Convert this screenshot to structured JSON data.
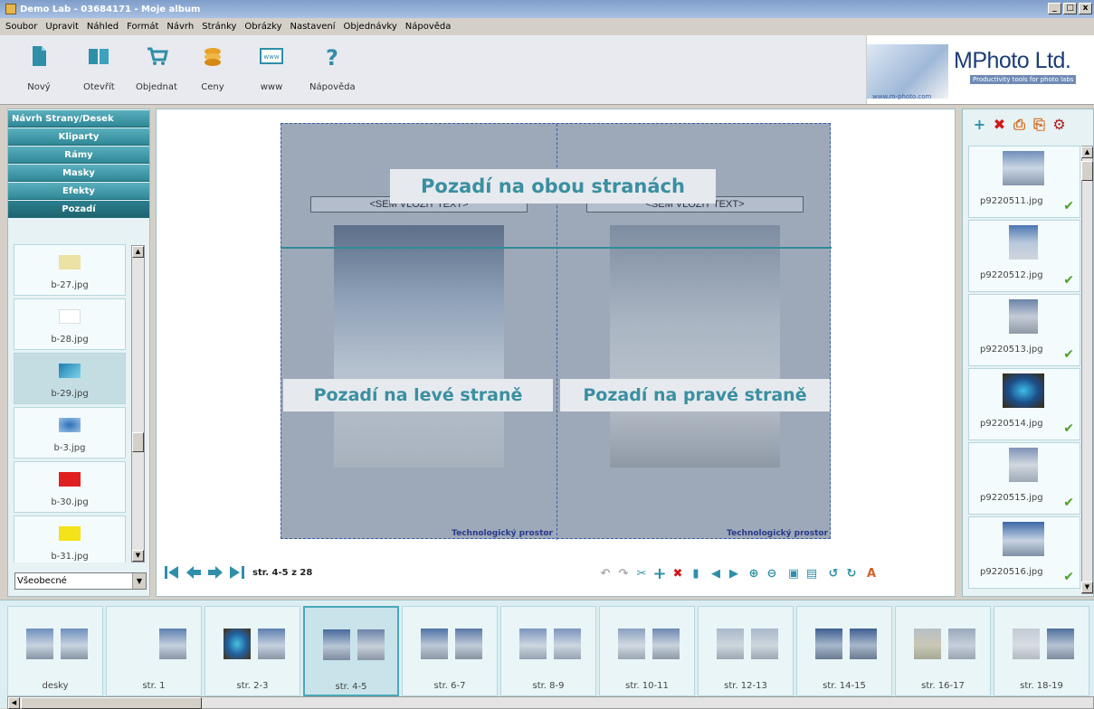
{
  "window": {
    "title": "Demo Lab - 03684171 - Moje album"
  },
  "menu": [
    "Soubor",
    "Upravit",
    "Náhled",
    "Formát",
    "Návrh",
    "Stránky",
    "Obrázky",
    "Nastavení",
    "Objednávky",
    "Nápověda"
  ],
  "toolbar": [
    {
      "label": "Nový",
      "icon": "new-document-icon"
    },
    {
      "label": "Otevřít",
      "icon": "open-book-icon"
    },
    {
      "label": "Objednat",
      "icon": "shopping-cart-icon"
    },
    {
      "label": "Ceny",
      "icon": "coins-icon"
    },
    {
      "label": "www",
      "icon": "www-icon"
    },
    {
      "label": "Nápověda",
      "icon": "help-question-icon"
    }
  ],
  "logo": {
    "url": "www.m-photo.com",
    "name": "MPhoto Ltd.",
    "tagline": "Productivity tools for photo labs"
  },
  "left_panel": {
    "categories": [
      "Návrh Strany/Desek",
      "Kliparty",
      "Rámy",
      "Masky",
      "Efekty",
      "Pozadí"
    ],
    "active_category": "Pozadí",
    "items": [
      {
        "name": "b-27.jpg",
        "color": "#ece2a5"
      },
      {
        "name": "b-28.jpg",
        "color": "#ffffff"
      },
      {
        "name": "b-29.jpg",
        "color": "#3aa8d0",
        "selected": true
      },
      {
        "name": "b-3.jpg",
        "color": "#3f86c8"
      },
      {
        "name": "b-30.jpg",
        "color": "#e02020"
      },
      {
        "name": "b-31.jpg",
        "color": "#f4e21a"
      }
    ],
    "dropdown_value": "Všeobecné"
  },
  "canvas": {
    "placeholder_left": "<SEM VLOŽIT TEXT>",
    "placeholder_right": "<SEM VLOŽIT TEXT>",
    "label_both": "Pozadí na obou stranách",
    "label_left": "Pozadí na levé straně",
    "label_right": "Pozadí na pravé straně",
    "corner_left": "Technologický prostor",
    "corner_right": "Technologický prostor",
    "page_info": "str. 4-5 z 28"
  },
  "right_panel": {
    "photos": [
      {
        "name": "p9220511.jpg",
        "checked": true
      },
      {
        "name": "p9220512.jpg",
        "checked": true
      },
      {
        "name": "p9220513.jpg",
        "checked": true
      },
      {
        "name": "p9220514.jpg",
        "checked": true
      },
      {
        "name": "p9220515.jpg",
        "checked": true
      },
      {
        "name": "p9220516.jpg",
        "checked": true
      }
    ]
  },
  "spreads": [
    {
      "label": "desky"
    },
    {
      "label": "str. 1"
    },
    {
      "label": "str. 2-3"
    },
    {
      "label": "str. 4-5",
      "selected": true
    },
    {
      "label": "str. 6-7"
    },
    {
      "label": "str. 8-9"
    },
    {
      "label": "str. 10-11"
    },
    {
      "label": "str. 12-13"
    },
    {
      "label": "str. 14-15"
    },
    {
      "label": "str. 16-17"
    },
    {
      "label": "str. 18-19"
    }
  ]
}
